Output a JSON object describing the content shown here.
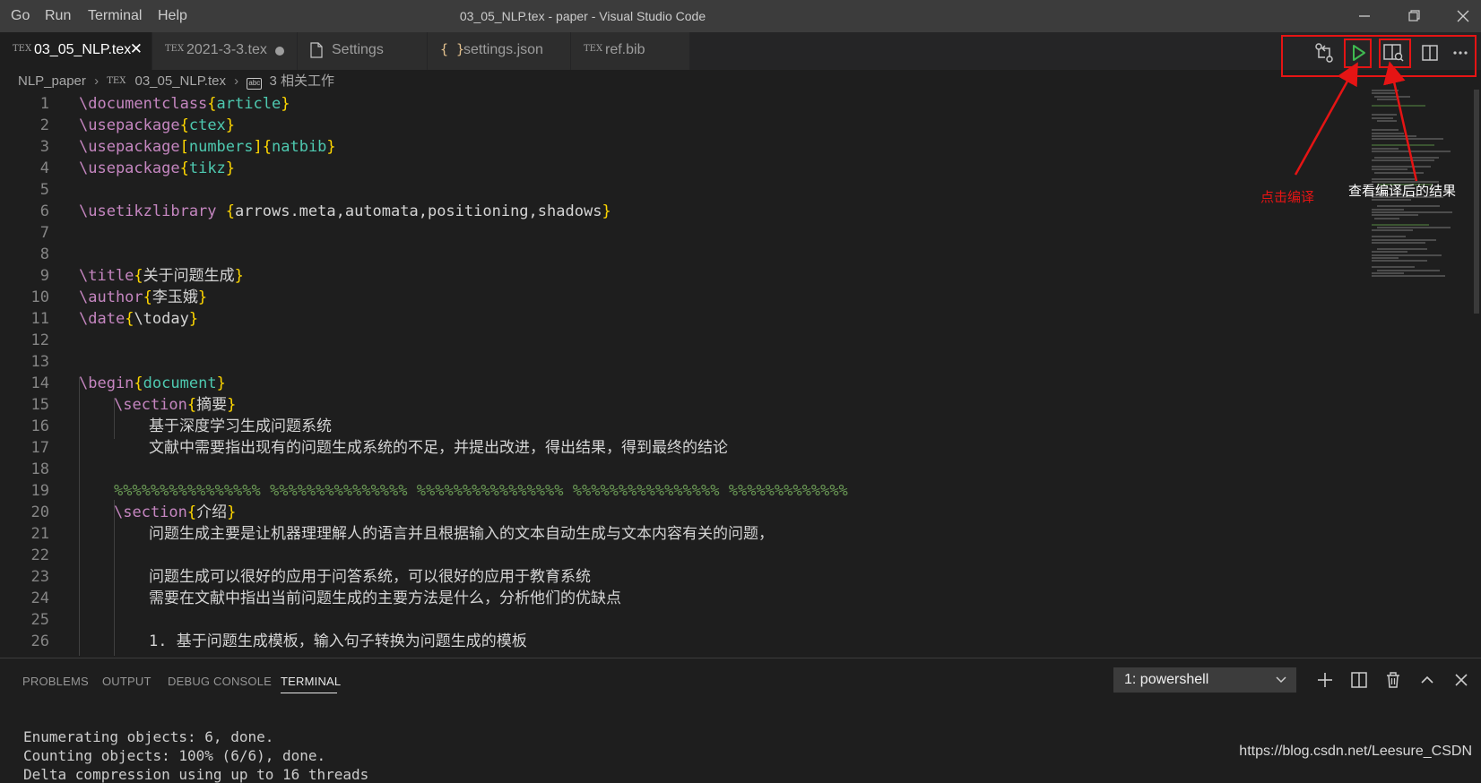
{
  "window": {
    "menu": [
      "Go",
      "Run",
      "Terminal",
      "Help"
    ],
    "title": "03_05_NLP.tex - paper - Visual Studio Code"
  },
  "tabs": [
    {
      "label": "03_05_NLP.tex",
      "icon": "tex-icon",
      "active": true,
      "close": "✕"
    },
    {
      "label": "2021-3-3.tex",
      "icon": "tex-icon",
      "active": false,
      "modified": true
    },
    {
      "label": "Settings",
      "icon": "file-icon",
      "active": false
    },
    {
      "label": "settings.json",
      "icon": "braces-icon",
      "active": false
    },
    {
      "label": "ref.bib",
      "icon": "tex-icon",
      "active": false
    }
  ],
  "tex_glyph": "TEX",
  "braces_glyph": "{ }",
  "breadcrumb": {
    "folder": "NLP_paper",
    "file": "03_05_NLP.tex",
    "symbol_icon": "abc",
    "section": "3 相关工作"
  },
  "editor_actions": [
    "git-compare-icon",
    "run-build-icon",
    "view-pdf-icon",
    "split-editor-icon",
    "more-actions-icon"
  ],
  "code_lines": [
    {
      "n": "1",
      "cmd": "\\documentclass",
      "open": "{",
      "arg": "article",
      "close": "}"
    },
    {
      "n": "2",
      "cmd": "\\usepackage",
      "open": "{",
      "arg": "ctex",
      "close": "}"
    },
    {
      "n": "3",
      "cmd": "\\usepackage",
      "open": "[",
      "arg": "numbers",
      "close": "]",
      "open2": "{",
      "arg2": "natbib",
      "close2": "}"
    },
    {
      "n": "4",
      "cmd": "\\usepackage",
      "open": "{",
      "arg": "tikz",
      "close": "}"
    },
    {
      "n": "5"
    },
    {
      "n": "6",
      "cmd": "\\usetikzlibrary",
      "sp": " ",
      "open": "{",
      "plain": "arrows.meta,automata,positioning,shadows",
      "close": "}"
    },
    {
      "n": "7"
    },
    {
      "n": "8"
    },
    {
      "n": "9",
      "cmd": "\\title",
      "open": "{",
      "plain": "关于问题生成",
      "close": "}"
    },
    {
      "n": "10",
      "cmd": "\\author",
      "open": "{",
      "plain": "李玉娥",
      "close": "}"
    },
    {
      "n": "11",
      "cmd": "\\date",
      "open": "{",
      "plain": "\\today",
      "close": "}"
    },
    {
      "n": "12"
    },
    {
      "n": "13"
    },
    {
      "n": "14",
      "cmd": "\\begin",
      "open": "{",
      "arg": "document",
      "close": "}"
    },
    {
      "n": "15",
      "indent": 1,
      "cmd": "\\section",
      "open": "{",
      "plain": "摘要",
      "close": "}"
    },
    {
      "n": "16",
      "indent": 2,
      "text": "基于深度学习生成问题系统"
    },
    {
      "n": "17",
      "indent": 2,
      "text": "文献中需要指出现有的问题生成系统的不足，并提出改进，得出结果，得到最终的结论"
    },
    {
      "n": "18"
    },
    {
      "n": "19",
      "indent": 1,
      "comment": "%%%%%%%%%%%%%%%% %%%%%%%%%%%%%%% %%%%%%%%%%%%%%%% %%%%%%%%%%%%%%%% %%%%%%%%%%%%%"
    },
    {
      "n": "20",
      "indent": 1,
      "cmd": "\\section",
      "open": "{",
      "plain": "介绍",
      "close": "}"
    },
    {
      "n": "21",
      "indent": 2,
      "text": "问题生成主要是让机器理理解人的语言并且根据输入的文本自动生成与文本内容有关的问题，"
    },
    {
      "n": "22"
    },
    {
      "n": "23",
      "indent": 2,
      "text": "问题生成可以很好的应用于问答系统，可以很好的应用于教育系统"
    },
    {
      "n": "24",
      "indent": 2,
      "text": "需要在文献中指出当前问题生成的主要方法是什么，分析他们的优缺点"
    },
    {
      "n": "25"
    },
    {
      "n": "26",
      "indent": 2,
      "text": "1. 基于问题生成模板，输入句子转换为问题生成的模板"
    }
  ],
  "annotations": {
    "compile": "点击编译",
    "view_result": "查看编译后的结果",
    "color": "#e51414"
  },
  "panel": {
    "tabs": [
      "PROBLEMS",
      "OUTPUT",
      "DEBUG CONSOLE",
      "TERMINAL"
    ],
    "active_tab": "TERMINAL",
    "terminal_select": "1: powershell",
    "actions": [
      "add-terminal-icon",
      "split-terminal-icon",
      "trash-icon",
      "maximize-panel-icon",
      "close-panel-icon"
    ],
    "terminal_lines": [
      "Enumerating objects: 6, done.",
      "Counting objects: 100% (6/6), done.",
      "Delta compression using up to 16 threads"
    ]
  },
  "watermark": "https://blog.csdn.net/Leesure_CSDN",
  "colors": {
    "keyword": "#c586c0",
    "bracket": "#ffd700",
    "argument": "#4ec9b0",
    "comment": "#6a9955",
    "run_icon": "#3fb950"
  }
}
